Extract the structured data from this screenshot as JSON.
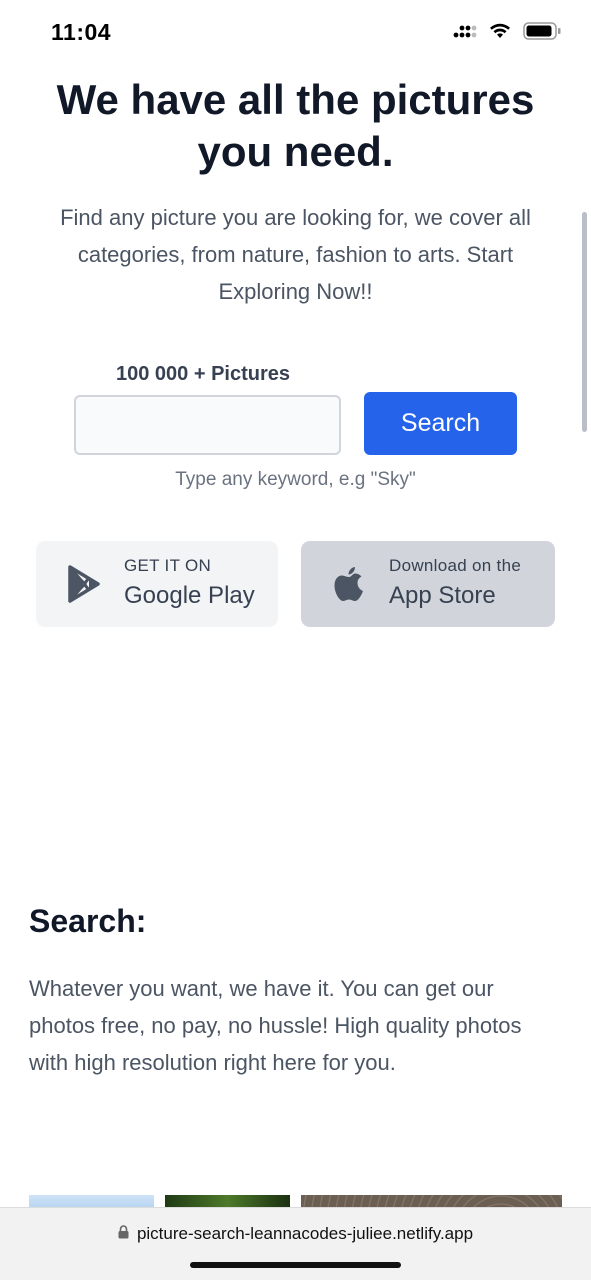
{
  "status_bar": {
    "time": "11:04",
    "icons": [
      "cellular-signal-icon",
      "wifi-icon",
      "battery-icon"
    ]
  },
  "hero": {
    "title_line1": "We have all the pictures",
    "title_line2": "you need.",
    "subtitle": "Find any picture you are looking for, we cover all categories, from nature, fashion to arts. Start Exploring Now!!"
  },
  "search": {
    "count_label": "100 000 + Pictures",
    "input_value": "",
    "input_placeholder": "",
    "button_label": "Search",
    "hint": "Type any keyword, e.g \"Sky\""
  },
  "stores": {
    "google": {
      "small": "GET IT ON",
      "big": "Google Play",
      "icon": "google-play-icon"
    },
    "apple": {
      "small": "Download on the",
      "big": "App Store",
      "icon": "apple-icon"
    }
  },
  "section": {
    "title": "Search:",
    "text": "Whatever you want, we have it. You can get our photos free, no pay, no hussle! High quality photos with high resolution right here for you."
  },
  "browser": {
    "url": "picture-search-leannacodes-juliee.netlify.app",
    "lock_icon": "lock-icon"
  },
  "colors": {
    "primary": "#2563eb",
    "heading": "#111827",
    "body_text": "#4b5563",
    "google_btn_bg": "#f3f4f6",
    "apple_btn_bg": "#d1d5db"
  }
}
